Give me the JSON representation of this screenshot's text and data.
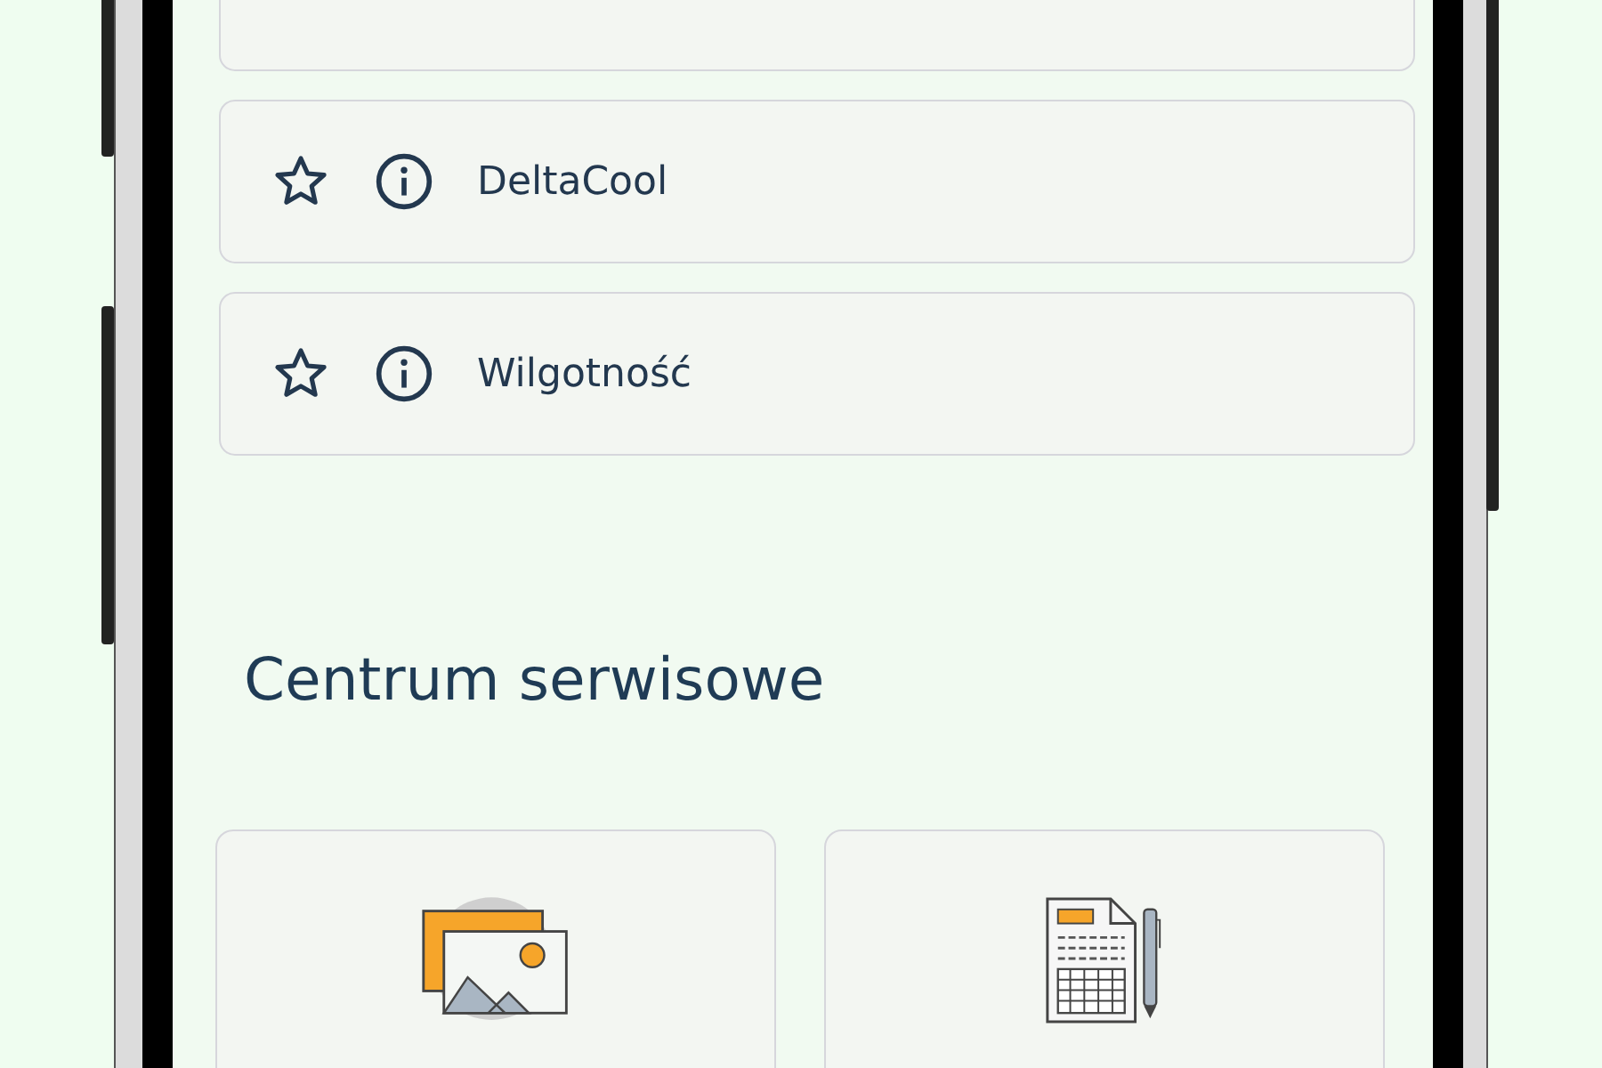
{
  "favorites": [
    {
      "label": "DeltaCool",
      "favorite": false
    },
    {
      "label": "Wilgotność",
      "favorite": false
    }
  ],
  "service_center": {
    "title": "Centrum serwisowe",
    "tiles": [
      {
        "kind": "gallery"
      },
      {
        "kind": "invoice"
      }
    ]
  }
}
